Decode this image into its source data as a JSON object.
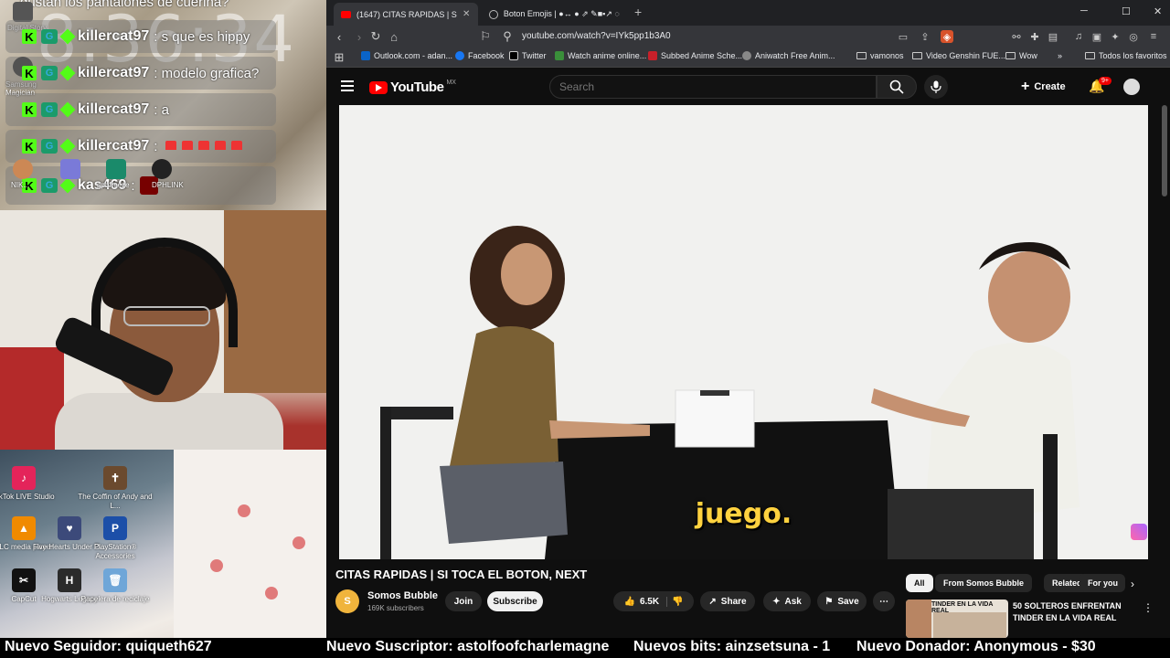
{
  "overlay": {
    "clock": "8:36:34",
    "chat_header": "gustan los pantalones de cuerina?",
    "chat": [
      {
        "user": "killercat97",
        "msg": ": s que es hippy"
      },
      {
        "user": "killercat97",
        "msg": ": modelo grafica?"
      },
      {
        "user": "killercat97",
        "msg": ": a"
      },
      {
        "user": "killercat97",
        "msg": ":"
      },
      {
        "user": "kas469",
        "msg": ":"
      }
    ],
    "desktop_top_labels": [
      "Digital Story",
      "Samsung Magician",
      "NIK...",
      "Chrome",
      "ppbfreeze",
      "DPHLINK"
    ],
    "desktop_icons": [
      {
        "label": "TikTok LIVE Studio",
        "color": "#e4245a",
        "glyph": "♪"
      },
      {
        "label": "The Coffin of Andy and L...",
        "color": "#6b4a2e",
        "glyph": "✝"
      },
      {
        "label": "VLC media player",
        "color": "#f08a00",
        "glyph": "▲"
      },
      {
        "label": "Five Hearts Under O...",
        "color": "#3c4a7a",
        "glyph": "♥"
      },
      {
        "label": "PlayStation® Accessories",
        "color": "#1c4fa8",
        "glyph": "P"
      },
      {
        "label": "CapCut",
        "color": "#111111",
        "glyph": "✂"
      },
      {
        "label": "Hogwarts Legacy",
        "color": "#2b2b2b",
        "glyph": "H"
      },
      {
        "label": "Papelera de reciclaje",
        "color": "#6fa6d8",
        "glyph": "🗑"
      }
    ]
  },
  "browser": {
    "tabs": [
      {
        "label": "(1647) CITAS RAPIDAS | SI TO..."
      },
      {
        "label": "Boton Emojis | ●↔ ● ⇗ ✎■▪↗ ◌"
      }
    ],
    "url": "youtube.com/watch?v=IYk5pp1b3A0",
    "bookmarks": [
      "Outlook.com - adan...",
      "Facebook",
      "Twitter",
      "Watch anime online...",
      "Subbed Anime Sche...",
      "Aniwatch Free Anim...",
      "vamonos",
      "Video Genshin FUE...",
      "Wow",
      "Todos los favoritos"
    ]
  },
  "youtube": {
    "logo": "YouTube",
    "country": "MX",
    "search_placeholder": "Search",
    "create_label": "Create",
    "notif_count": "9+",
    "subtitle": "juego.",
    "video_title": "CITAS RAPIDAS | SI TOCA EL BOTON, NEXT",
    "channel_name": "Somos Bubble",
    "channel_subs": "169K subscribers",
    "join_label": "Join",
    "subscribe_label": "Subscribe",
    "likes": "6.5K",
    "share_label": "Share",
    "ask_label": "Ask",
    "save_label": "Save",
    "chips": [
      "All",
      "From Somos Bubble",
      "Related",
      "For you"
    ],
    "rec_thumb_text": "TINDER EN LA VIDA REAL",
    "rec_title": "50 SOLTEROS ENFRENTAN TINDER EN LA VIDA REAL"
  },
  "ticker": {
    "follower": "Nuevo Seguidor: quiqueth627",
    "subscriber": "Nuevo Suscriptor: astolfoofcharlemagne",
    "bits": "Nuevos bits: ainzsetsuna - 1",
    "donor": "Nuevo Donador: Anonymous - $30"
  }
}
